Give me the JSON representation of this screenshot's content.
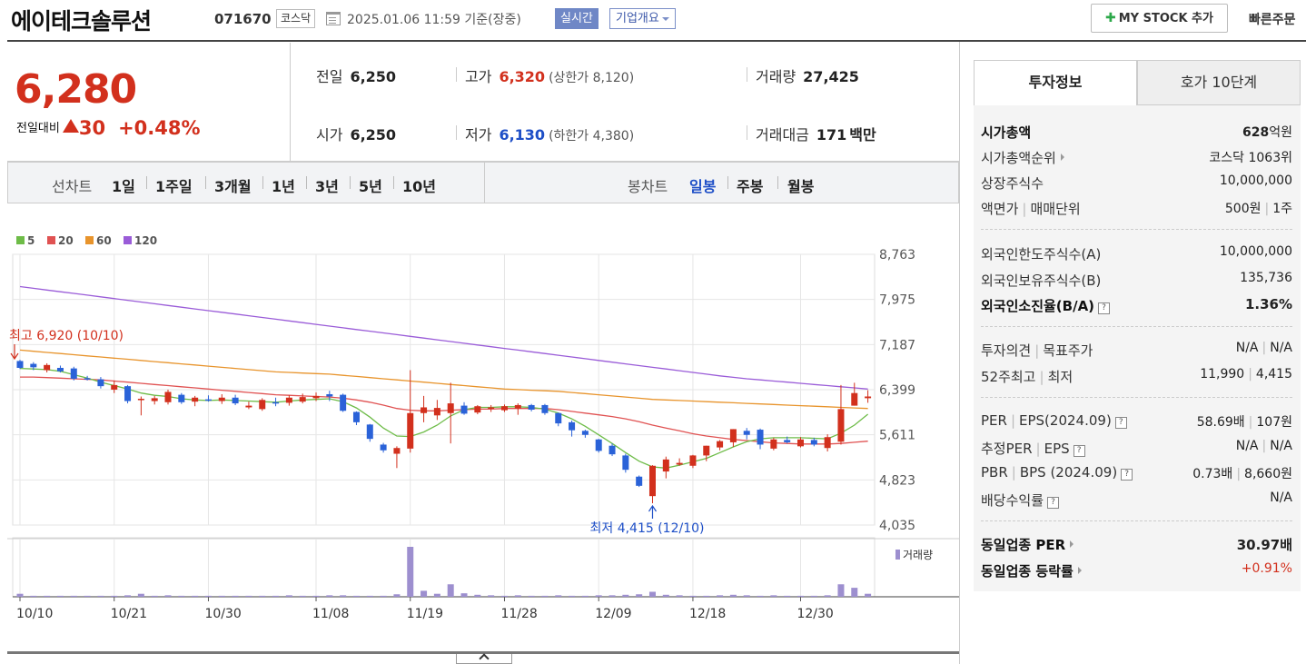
{
  "header": {
    "title": "에이테크솔루션",
    "code": "071670",
    "market": "코스닥",
    "datetime": "2025.01.06 11:59  기준(장중)",
    "realtime": "실시간",
    "overview": "기업개요",
    "mystock": "MY STOCK 추가",
    "quick_order": "빠른주문"
  },
  "price": {
    "current": "6,280",
    "change_label": "전일대비",
    "change_amount": "30",
    "change_percent": "+0.48%",
    "prev_close_label": "전일",
    "prev_close": "6,250",
    "open_label": "시가",
    "open": "6,250",
    "high_label": "고가",
    "high": "6,320",
    "upper_limit": "(상한가 8,120)",
    "low_label": "저가",
    "low": "6,130",
    "lower_limit": "(하한가 4,380)",
    "volume_label": "거래량",
    "volume": "27,425",
    "amount_label": "거래대금",
    "amount": "171",
    "amount_unit": "백만"
  },
  "chart_nav": {
    "line_label": "선차트",
    "line_periods": [
      "1일",
      "1주일",
      "3개월",
      "1년",
      "3년",
      "5년",
      "10년"
    ],
    "candle_label": "봉차트",
    "candle_periods": [
      "일봉",
      "주봉",
      "월봉"
    ],
    "active_candle": "일봉"
  },
  "colors": {
    "up": "#d2301d",
    "down": "#2a62d8",
    "ma5": "#6ebc48",
    "ma20": "#e05252",
    "ma60": "#e8942c",
    "ma120": "#9a5cd8",
    "volume": "#9d8fcf"
  },
  "chart_data": {
    "type": "candlestick",
    "legend": [
      "5",
      "20",
      "60",
      "120"
    ],
    "y_ticks": [
      "8,763",
      "7,975",
      "7,187",
      "6,399",
      "5,611",
      "4,823",
      "4,035"
    ],
    "ylim": [
      4035,
      8763
    ],
    "x_ticks": [
      "10/10",
      "10/21",
      "10/30",
      "11/08",
      "11/19",
      "11/28",
      "12/09",
      "12/18",
      "12/30"
    ],
    "high_annotation": "최고 6,920 (10/10)",
    "low_annotation": "최저 4,415 (12/10)",
    "volume_label": "거래량",
    "candles": [
      {
        "o": 6900,
        "h": 6920,
        "l": 6760,
        "c": 6780
      },
      {
        "o": 6850,
        "h": 6880,
        "l": 6740,
        "c": 6790
      },
      {
        "o": 6740,
        "h": 6860,
        "l": 6700,
        "c": 6830
      },
      {
        "o": 6780,
        "h": 6820,
        "l": 6700,
        "c": 6720
      },
      {
        "o": 6770,
        "h": 6800,
        "l": 6560,
        "c": 6590
      },
      {
        "o": 6600,
        "h": 6640,
        "l": 6560,
        "c": 6590
      },
      {
        "o": 6580,
        "h": 6620,
        "l": 6420,
        "c": 6460
      },
      {
        "o": 6400,
        "h": 6560,
        "l": 6340,
        "c": 6480
      },
      {
        "o": 6460,
        "h": 6480,
        "l": 6160,
        "c": 6200
      },
      {
        "o": 6240,
        "h": 6280,
        "l": 5950,
        "c": 6240
      },
      {
        "o": 6200,
        "h": 6290,
        "l": 6140,
        "c": 6250
      },
      {
        "o": 6180,
        "h": 6400,
        "l": 6140,
        "c": 6360
      },
      {
        "o": 6310,
        "h": 6340,
        "l": 6150,
        "c": 6180
      },
      {
        "o": 6190,
        "h": 6290,
        "l": 6110,
        "c": 6260
      },
      {
        "o": 6230,
        "h": 6300,
        "l": 6190,
        "c": 6210
      },
      {
        "o": 6200,
        "h": 6320,
        "l": 6150,
        "c": 6260
      },
      {
        "o": 6260,
        "h": 6310,
        "l": 6130,
        "c": 6160
      },
      {
        "o": 6090,
        "h": 6190,
        "l": 6060,
        "c": 6120
      },
      {
        "o": 6060,
        "h": 6250,
        "l": 6030,
        "c": 6220
      },
      {
        "o": 6180,
        "h": 6260,
        "l": 6110,
        "c": 6160
      },
      {
        "o": 6170,
        "h": 6300,
        "l": 6120,
        "c": 6260
      },
      {
        "o": 6190,
        "h": 6330,
        "l": 6160,
        "c": 6270
      },
      {
        "o": 6250,
        "h": 6350,
        "l": 6200,
        "c": 6290
      },
      {
        "o": 6320,
        "h": 6380,
        "l": 6200,
        "c": 6280
      },
      {
        "o": 6310,
        "h": 6330,
        "l": 6010,
        "c": 6030
      },
      {
        "o": 6010,
        "h": 6020,
        "l": 5780,
        "c": 5830
      },
      {
        "o": 5790,
        "h": 5800,
        "l": 5490,
        "c": 5540
      },
      {
        "o": 5440,
        "h": 5470,
        "l": 5300,
        "c": 5340
      },
      {
        "o": 5280,
        "h": 5410,
        "l": 5030,
        "c": 5380
      },
      {
        "o": 5370,
        "h": 6740,
        "l": 5300,
        "c": 5990
      },
      {
        "o": 5990,
        "h": 6290,
        "l": 5830,
        "c": 6090
      },
      {
        "o": 5950,
        "h": 6220,
        "l": 5870,
        "c": 6080
      },
      {
        "o": 5990,
        "h": 6520,
        "l": 5460,
        "c": 6160
      },
      {
        "o": 6120,
        "h": 6180,
        "l": 5960,
        "c": 5980
      },
      {
        "o": 6000,
        "h": 6130,
        "l": 5970,
        "c": 6110
      },
      {
        "o": 6070,
        "h": 6130,
        "l": 6010,
        "c": 6090
      },
      {
        "o": 6040,
        "h": 6140,
        "l": 6010,
        "c": 6110
      },
      {
        "o": 6070,
        "h": 6160,
        "l": 5960,
        "c": 6130
      },
      {
        "o": 6130,
        "h": 6150,
        "l": 6020,
        "c": 6050
      },
      {
        "o": 6130,
        "h": 6150,
        "l": 5960,
        "c": 5990
      },
      {
        "o": 5990,
        "h": 6000,
        "l": 5760,
        "c": 5810
      },
      {
        "o": 5830,
        "h": 5860,
        "l": 5580,
        "c": 5690
      },
      {
        "o": 5680,
        "h": 5700,
        "l": 5560,
        "c": 5610
      },
      {
        "o": 5530,
        "h": 5540,
        "l": 5300,
        "c": 5330
      },
      {
        "o": 5420,
        "h": 5460,
        "l": 5240,
        "c": 5270
      },
      {
        "o": 5250,
        "h": 5280,
        "l": 4950,
        "c": 5000
      },
      {
        "o": 4880,
        "h": 4900,
        "l": 4700,
        "c": 4720
      },
      {
        "o": 4540,
        "h": 5080,
        "l": 4415,
        "c": 5070
      },
      {
        "o": 4970,
        "h": 5230,
        "l": 4850,
        "c": 5180
      },
      {
        "o": 5090,
        "h": 5200,
        "l": 5070,
        "c": 5120
      },
      {
        "o": 5070,
        "h": 5260,
        "l": 5030,
        "c": 5250
      },
      {
        "o": 5250,
        "h": 5420,
        "l": 5150,
        "c": 5420
      },
      {
        "o": 5390,
        "h": 5520,
        "l": 5340,
        "c": 5500
      },
      {
        "o": 5480,
        "h": 5710,
        "l": 5400,
        "c": 5710
      },
      {
        "o": 5680,
        "h": 5730,
        "l": 5530,
        "c": 5610
      },
      {
        "o": 5700,
        "h": 5720,
        "l": 5360,
        "c": 5440
      },
      {
        "o": 5370,
        "h": 5560,
        "l": 5340,
        "c": 5530
      },
      {
        "o": 5520,
        "h": 5580,
        "l": 5460,
        "c": 5480
      },
      {
        "o": 5410,
        "h": 5570,
        "l": 5390,
        "c": 5530
      },
      {
        "o": 5520,
        "h": 5560,
        "l": 5410,
        "c": 5440
      },
      {
        "o": 5380,
        "h": 5620,
        "l": 5320,
        "c": 5570
      },
      {
        "o": 5490,
        "h": 6480,
        "l": 5440,
        "c": 6060
      },
      {
        "o": 6120,
        "h": 6520,
        "l": 6120,
        "c": 6340
      },
      {
        "o": 6250,
        "h": 6390,
        "l": 6170,
        "c": 6280
      }
    ],
    "ma5": [
      6770,
      6760,
      6750,
      6720,
      6660,
      6600,
      6530,
      6470,
      6410,
      6340,
      6300,
      6280,
      6240,
      6220,
      6210,
      6220,
      6210,
      6200,
      6190,
      6180,
      6200,
      6220,
      6230,
      6240,
      6190,
      6080,
      5920,
      5730,
      5590,
      5580,
      5660,
      5780,
      5940,
      6050,
      6090,
      6090,
      6100,
      6100,
      6090,
      6060,
      5990,
      5890,
      5760,
      5610,
      5460,
      5300,
      5150,
      5050,
      5030,
      5080,
      5140,
      5200,
      5300,
      5400,
      5490,
      5540,
      5560,
      5560,
      5560,
      5550,
      5540,
      5640,
      5780,
      5970
    ],
    "ma20": [
      6620,
      6620,
      6610,
      6600,
      6590,
      6580,
      6570,
      6550,
      6530,
      6510,
      6490,
      6470,
      6450,
      6430,
      6410,
      6390,
      6370,
      6350,
      6330,
      6310,
      6300,
      6290,
      6280,
      6270,
      6250,
      6220,
      6180,
      6130,
      6070,
      6040,
      6030,
      6030,
      6040,
      6050,
      6060,
      6060,
      6070,
      6070,
      6070,
      6070,
      6050,
      6020,
      5990,
      5960,
      5930,
      5890,
      5840,
      5780,
      5730,
      5680,
      5630,
      5590,
      5560,
      5530,
      5510,
      5490,
      5470,
      5460,
      5450,
      5450,
      5450,
      5460,
      5480,
      5500
    ],
    "ma60": [
      7090,
      7070,
      7050,
      7030,
      7010,
      6990,
      6970,
      6950,
      6930,
      6910,
      6890,
      6870,
      6850,
      6830,
      6810,
      6790,
      6770,
      6750,
      6730,
      6710,
      6700,
      6690,
      6680,
      6670,
      6650,
      6630,
      6610,
      6590,
      6570,
      6550,
      6530,
      6510,
      6490,
      6470,
      6450,
      6430,
      6410,
      6400,
      6390,
      6380,
      6370,
      6350,
      6330,
      6310,
      6290,
      6270,
      6250,
      6230,
      6220,
      6210,
      6200,
      6190,
      6180,
      6170,
      6160,
      6150,
      6140,
      6130,
      6120,
      6110,
      6100,
      6090,
      6080,
      6070
    ],
    "ma120": [
      8200,
      8170,
      8140,
      8110,
      8080,
      8050,
      8020,
      7990,
      7960,
      7930,
      7900,
      7870,
      7840,
      7810,
      7780,
      7750,
      7720,
      7690,
      7660,
      7630,
      7600,
      7570,
      7540,
      7510,
      7480,
      7450,
      7420,
      7390,
      7360,
      7330,
      7300,
      7270,
      7240,
      7210,
      7180,
      7150,
      7120,
      7090,
      7060,
      7030,
      7000,
      6970,
      6940,
      6910,
      6880,
      6850,
      6820,
      6790,
      6760,
      6730,
      6700,
      6670,
      6640,
      6615,
      6590,
      6570,
      6550,
      6530,
      6510,
      6490,
      6470,
      6450,
      6430,
      6410
    ],
    "volumes": [
      6,
      2,
      2,
      2,
      2,
      2,
      2,
      2,
      3,
      6,
      2,
      3,
      2,
      2,
      2,
      2,
      2,
      2,
      2,
      2,
      3,
      2,
      2,
      3,
      3,
      2,
      2,
      2,
      5,
      100,
      12,
      6,
      25,
      7,
      4,
      3,
      2,
      3,
      2,
      2,
      3,
      2,
      2,
      3,
      3,
      4,
      5,
      10,
      4,
      3,
      2,
      2,
      3,
      4,
      3,
      2,
      3,
      2,
      2,
      2,
      3,
      25,
      18,
      6
    ]
  },
  "right_panel": {
    "tab_invest": "투자정보",
    "tab_hoga": "호가 10단계",
    "market_cap_label": "시가총액",
    "market_cap": "628",
    "market_cap_unit": "억원",
    "cap_rank_label": "시가총액순위",
    "cap_rank": "코스닥 1063위",
    "shares_label": "상장주식수",
    "shares": "10,000,000",
    "face_label": "액면가",
    "trade_unit_label": "매매단위",
    "face_value": "500원",
    "trade_unit": "1주",
    "foreign_limit_label": "외국인한도주식수(A)",
    "foreign_limit": "10,000,000",
    "foreign_hold_label": "외국인보유주식수(B)",
    "foreign_hold": "135,736",
    "foreign_rate_label": "외국인소진율(B/A)",
    "foreign_rate": "1.36%",
    "opinion_label": "투자의견",
    "target_label": "목표주가",
    "opinion": "N/A",
    "target": "N/A",
    "w52_high_label": "52주최고",
    "w52_low_label": "최저",
    "w52_high": "11,990",
    "w52_low": "4,415",
    "per_label": "PER",
    "eps_label": "EPS(2024.09)",
    "per": "58.69배",
    "eps": "107원",
    "est_per_label": "추정PER",
    "est_eps_label": "EPS",
    "est_per": "N/A",
    "est_eps": "N/A",
    "pbr_label": "PBR",
    "bps_label": "BPS (2024.09)",
    "pbr": "0.73배",
    "bps": "8,660원",
    "dividend_label": "배당수익률",
    "dividend": "N/A",
    "sector_per_label": "동일업종 PER",
    "sector_per": "30.97배",
    "sector_rate_label": "동일업종 등락률",
    "sector_rate": "+0.91%"
  }
}
